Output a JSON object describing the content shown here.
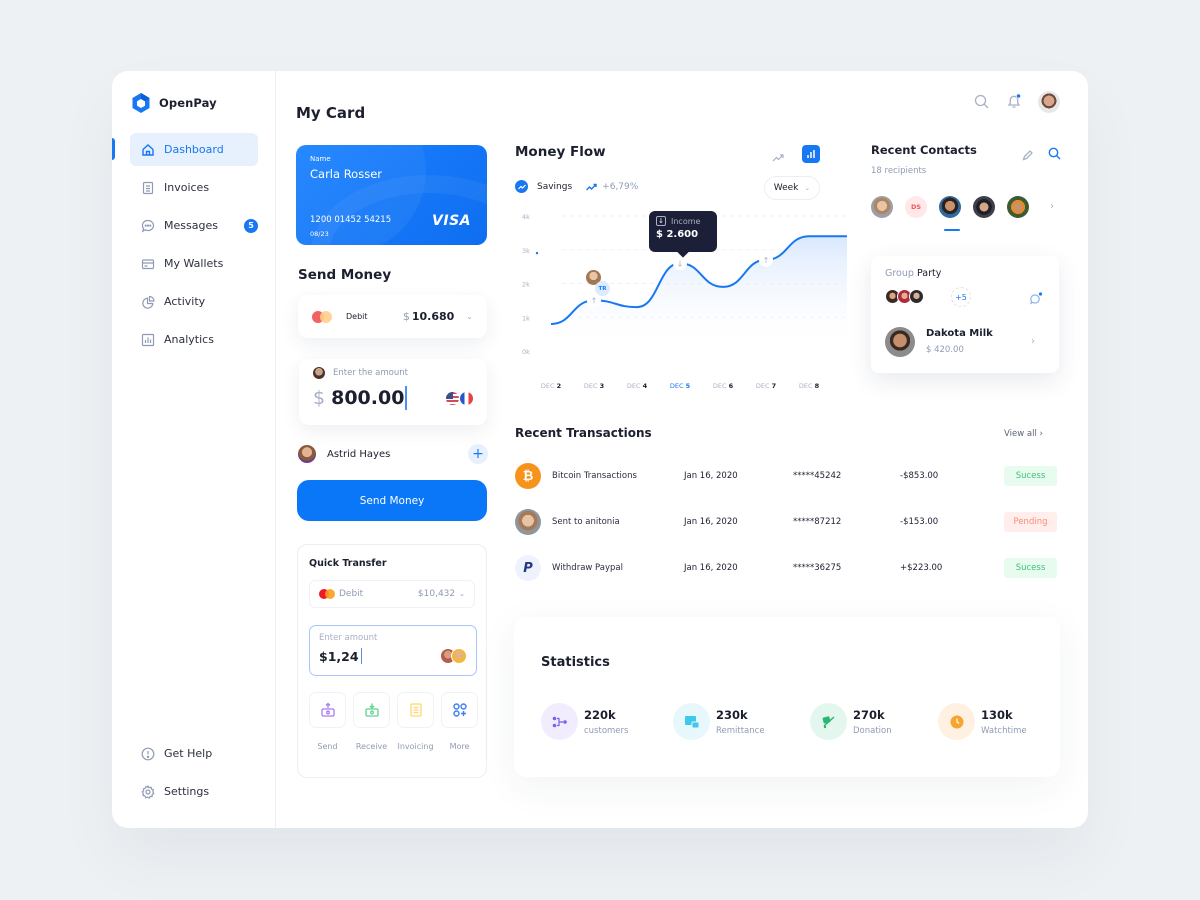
{
  "app": {
    "name": "OpenPay"
  },
  "sidebar": {
    "items": [
      {
        "label": "Dashboard",
        "icon": "home-icon",
        "active": true
      },
      {
        "label": "Invoices",
        "icon": "invoice-icon"
      },
      {
        "label": "Messages",
        "icon": "message-icon",
        "badge": "5"
      },
      {
        "label": "My Wallets",
        "icon": "wallet-icon"
      },
      {
        "label": "Activity",
        "icon": "pie-chart-icon"
      },
      {
        "label": "Analytics",
        "icon": "bar-chart-icon"
      }
    ],
    "bottom": [
      {
        "label": "Get Help",
        "icon": "help-icon"
      },
      {
        "label": "Settings",
        "icon": "gear-icon"
      }
    ]
  },
  "my_card": {
    "title": "My Card",
    "name_label": "Name",
    "name": "Carla Rosser",
    "number": "1200 01452 54215",
    "expiry": "08/23",
    "brand": "VISA"
  },
  "send_money": {
    "title": "Send Money",
    "account_label": "Debit",
    "currency_symbol": "$",
    "balance": "10.680",
    "amount_hint": "Enter the amount",
    "amount": "800.00",
    "recipient": "Astrid Hayes",
    "button_label": "Send Money"
  },
  "quick_transfer": {
    "title": "Quick Transfer",
    "account_label": "Debit",
    "balance": "$10,432",
    "input_placeholder": "Enter amount",
    "input_value": "$1,24",
    "actions": [
      {
        "label": "Send",
        "icon": "send-icon",
        "color": "#a77bf3"
      },
      {
        "label": "Receive",
        "icon": "receive-icon",
        "color": "#5fd38d"
      },
      {
        "label": "Invoicing",
        "icon": "invoice-icon",
        "color": "#ffd86b"
      },
      {
        "label": "More",
        "icon": "more-apps-icon",
        "color": "#3f7cf4"
      }
    ]
  },
  "money_flow": {
    "title": "Money Flow",
    "legend_label": "Savings",
    "change": "+6,79%",
    "period": "Week",
    "tooltip": {
      "label": "Income",
      "value": "$ 2.600"
    },
    "marker_badge": "TR"
  },
  "chart_data": {
    "type": "area",
    "title": "Money Flow",
    "series": [
      {
        "name": "Savings",
        "values": [
          0.8,
          1.5,
          1.3,
          2.6,
          1.9,
          2.7,
          3.4
        ]
      }
    ],
    "categories": [
      "DEC 2",
      "DEC 3",
      "DEC 4",
      "DEC 5",
      "DEC 6",
      "DEC 7",
      "DEC 8"
    ],
    "highlighted_category": "DEC 5",
    "y_ticks": [
      "0k",
      "1k",
      "2k",
      "3k",
      "4k"
    ],
    "ylim": [
      0,
      4
    ],
    "xlabel": "",
    "ylabel": "",
    "grid": true,
    "markers": [
      {
        "category": "DEC 3",
        "direction": "up"
      },
      {
        "category": "DEC 5",
        "direction": "down"
      },
      {
        "category": "DEC 7",
        "direction": "up"
      }
    ]
  },
  "recent_contacts": {
    "title": "Recent Contacts",
    "subtitle": "18 recipients",
    "initials_contact": "DS",
    "group": {
      "label_prefix": "Group",
      "label": "Party",
      "more": "+5"
    },
    "featured": {
      "name": "Dakota Milk",
      "amount": "$ 420.00"
    }
  },
  "transactions": {
    "title": "Recent Transactions",
    "view_all": "View all",
    "rows": [
      {
        "name": "Bitcoin Transactions",
        "date": "Jan 16, 2020",
        "account": "*****45242",
        "amount": "-$853.00",
        "status": "Sucess",
        "type": "bitcoin"
      },
      {
        "name": "Sent to anitonia",
        "date": "Jan 16, 2020",
        "account": "*****87212",
        "amount": "-$153.00",
        "status": "Pending",
        "type": "person"
      },
      {
        "name": "Withdraw Paypal",
        "date": "Jan 16, 2020",
        "account": "*****36275",
        "amount": "+$223.00",
        "status": "Sucess",
        "type": "paypal"
      }
    ]
  },
  "statistics": {
    "title": "Statistics",
    "items": [
      {
        "value": "220k",
        "label": "customers",
        "color": "#7b61f0",
        "bg": "#f1edfe"
      },
      {
        "value": "230k",
        "label": "Remittance",
        "color": "#3ec8ec",
        "bg": "#e6f8fc"
      },
      {
        "value": "270k",
        "label": "Donation",
        "color": "#2bb673",
        "bg": "#e4f7ee"
      },
      {
        "value": "130k",
        "label": "Watchtime",
        "color": "#f7a531",
        "bg": "#fff1e2"
      }
    ]
  }
}
